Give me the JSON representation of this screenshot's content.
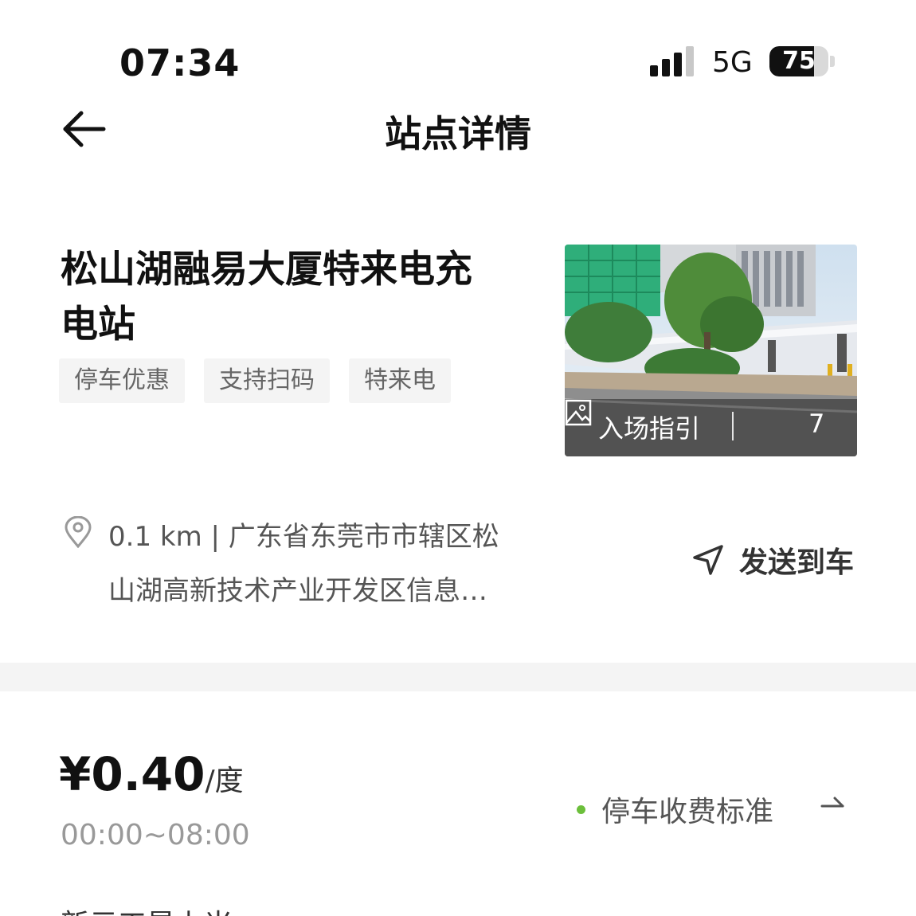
{
  "status_bar": {
    "time": "07:34",
    "network": "5G",
    "battery": "75",
    "battery_level": 0.75
  },
  "header": {
    "title": "站点详情"
  },
  "station": {
    "name": "松山湖融易大厦特来电充电站",
    "tags": [
      "停车优惠",
      "支持扫码",
      "特来电"
    ],
    "photo": {
      "guide_label": "入场指引",
      "count": "7"
    }
  },
  "address": {
    "distance": "0.1 km",
    "line1": "广东省东莞市市辖区松",
    "line2": "山湖高新技术产业开发区信息…",
    "send_label": "发送到车"
  },
  "price": {
    "amount": "¥0.40",
    "unit": "/度",
    "time_range": "00:00~08:00",
    "parking_fee_label": "停车收费标准"
  },
  "partial_text": "新元工是上米"
}
